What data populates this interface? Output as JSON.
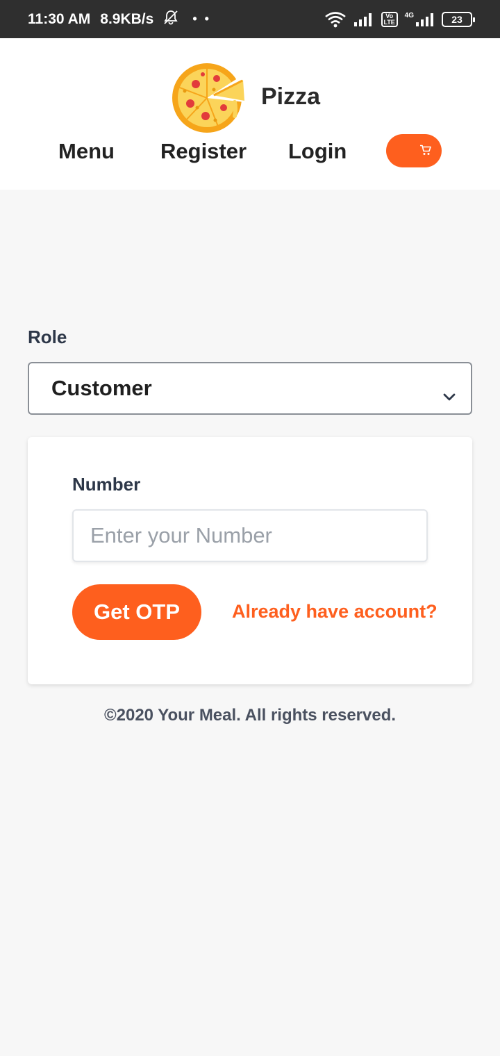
{
  "status_bar": {
    "time": "11:30 AM",
    "speed": "8.9KB/s",
    "dots": "• •",
    "network_label": "4G",
    "volte_top": "Vo",
    "volte_bottom": "LTE",
    "battery": "23"
  },
  "header": {
    "brand": "Pizza",
    "nav": {
      "menu": "Menu",
      "register": "Register",
      "login": "Login"
    }
  },
  "form": {
    "role_label": "Role",
    "role_value": "Customer",
    "number_label": "Number",
    "number_placeholder": "Enter your Number",
    "otp_button": "Get OTP",
    "account_link": "Already have account?"
  },
  "footer": {
    "copyright": "©2020 Your Meal. All rights reserved."
  },
  "colors": {
    "accent": "#fe5f1e",
    "status_bar": "#2f2f2f",
    "background": "#f7f7f7"
  },
  "icons": {
    "logo": "pizza-icon",
    "cart": "cart-icon",
    "select": "chevron-down-icon"
  }
}
